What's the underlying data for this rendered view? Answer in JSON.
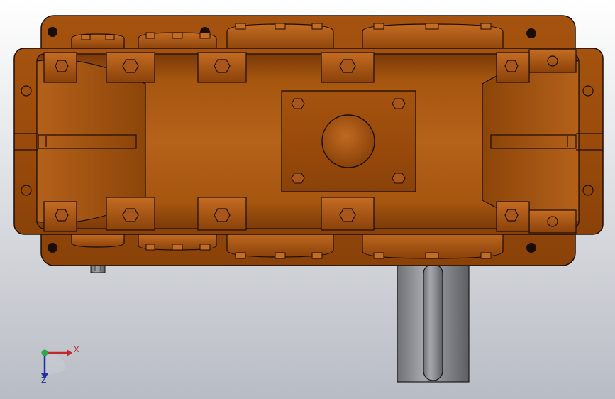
{
  "viewport": {
    "background_top": "#ffffff",
    "background_bottom": "#b8bcc4"
  },
  "model": {
    "body_color": "#9e4e0c",
    "body_highlight": "#c06a22",
    "body_shadow": "#6a3208",
    "edge_color": "#1a0d04",
    "shaft_color": "#8e9096"
  },
  "triad": {
    "x_label": "X",
    "z_label": "Z",
    "x_color": "#c0282c",
    "y_color": "#2aa84a",
    "z_color": "#2030a0"
  }
}
